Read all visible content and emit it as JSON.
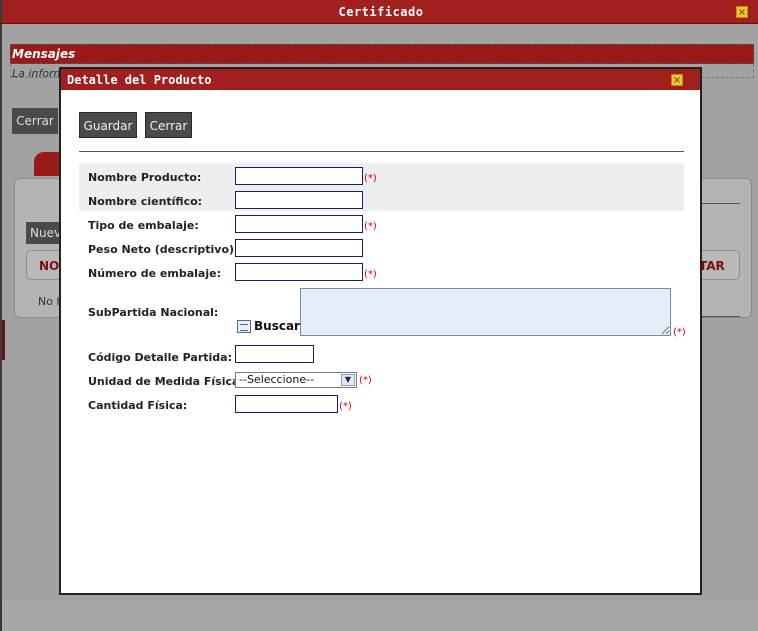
{
  "window": {
    "title": "Certificado",
    "close_glyph": "×"
  },
  "background": {
    "messages_title": "Mensajes",
    "messages_text": "La inform",
    "cerrar_button": "Cerrar",
    "tab_letter": "D",
    "nuevo_button": "Nuev",
    "table_col_left": "NOM",
    "table_col_right": "TAR",
    "no_records": "No h"
  },
  "modal": {
    "title": "Detalle del Producto",
    "close_glyph": "×",
    "buttons": {
      "save": "Guardar",
      "close": "Cerrar"
    },
    "required_marker": "(*)",
    "fields": {
      "nombre_producto": {
        "label": "Nombre Producto:",
        "value": ""
      },
      "nombre_cientifico": {
        "label": "Nombre científico:",
        "value": ""
      },
      "tipo_embalaje": {
        "label": "Tipo de embalaje:",
        "value": ""
      },
      "peso_neto": {
        "label": "Peso Neto (descriptivo):",
        "value": ""
      },
      "numero_embalaje": {
        "label": "Número de embalaje:",
        "value": ""
      },
      "subpartida": {
        "label": "SubPartida Nacional:",
        "search_label": "Buscar",
        "value": ""
      },
      "codigo_detalle": {
        "label": "Código Detalle Partida:",
        "value": ""
      },
      "unidad_medida": {
        "label": "Unidad de Medida Física:",
        "selected": "--Seleccione--"
      },
      "cantidad_fisica": {
        "label": "Cantidad Física:",
        "value": ""
      }
    }
  },
  "colors": {
    "title_bar": "#a11f1f",
    "required": "#dd0000"
  }
}
